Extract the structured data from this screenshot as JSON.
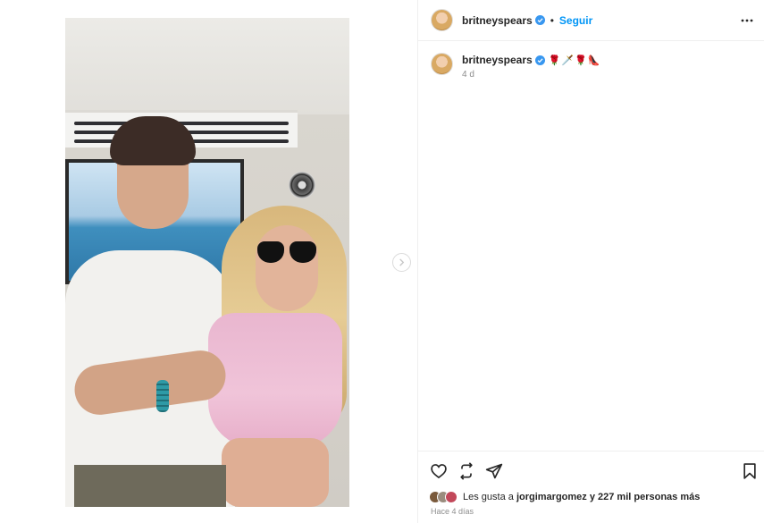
{
  "post": {
    "username": "britneyspears",
    "follow_label": "Seguir",
    "separator": "•",
    "caption_emojis": "🌹🗡️🌹👠",
    "caption_time": "4 d",
    "likes_prefix": "Les gusta a ",
    "likes_user": "jorgimargomez",
    "likes_suffix": " y 227 mil personas más",
    "posted_ago": "Hace 4 días"
  },
  "icons": {
    "verified": "verified-badge-icon",
    "more": "more-options-icon",
    "next": "chevron-right-icon",
    "like": "heart-icon",
    "repost": "repost-icon",
    "share": "send-icon",
    "save": "bookmark-icon"
  },
  "colors": {
    "link_blue": "#0095f6",
    "verified_blue": "#3897f0",
    "muted": "#8e8e8e"
  }
}
